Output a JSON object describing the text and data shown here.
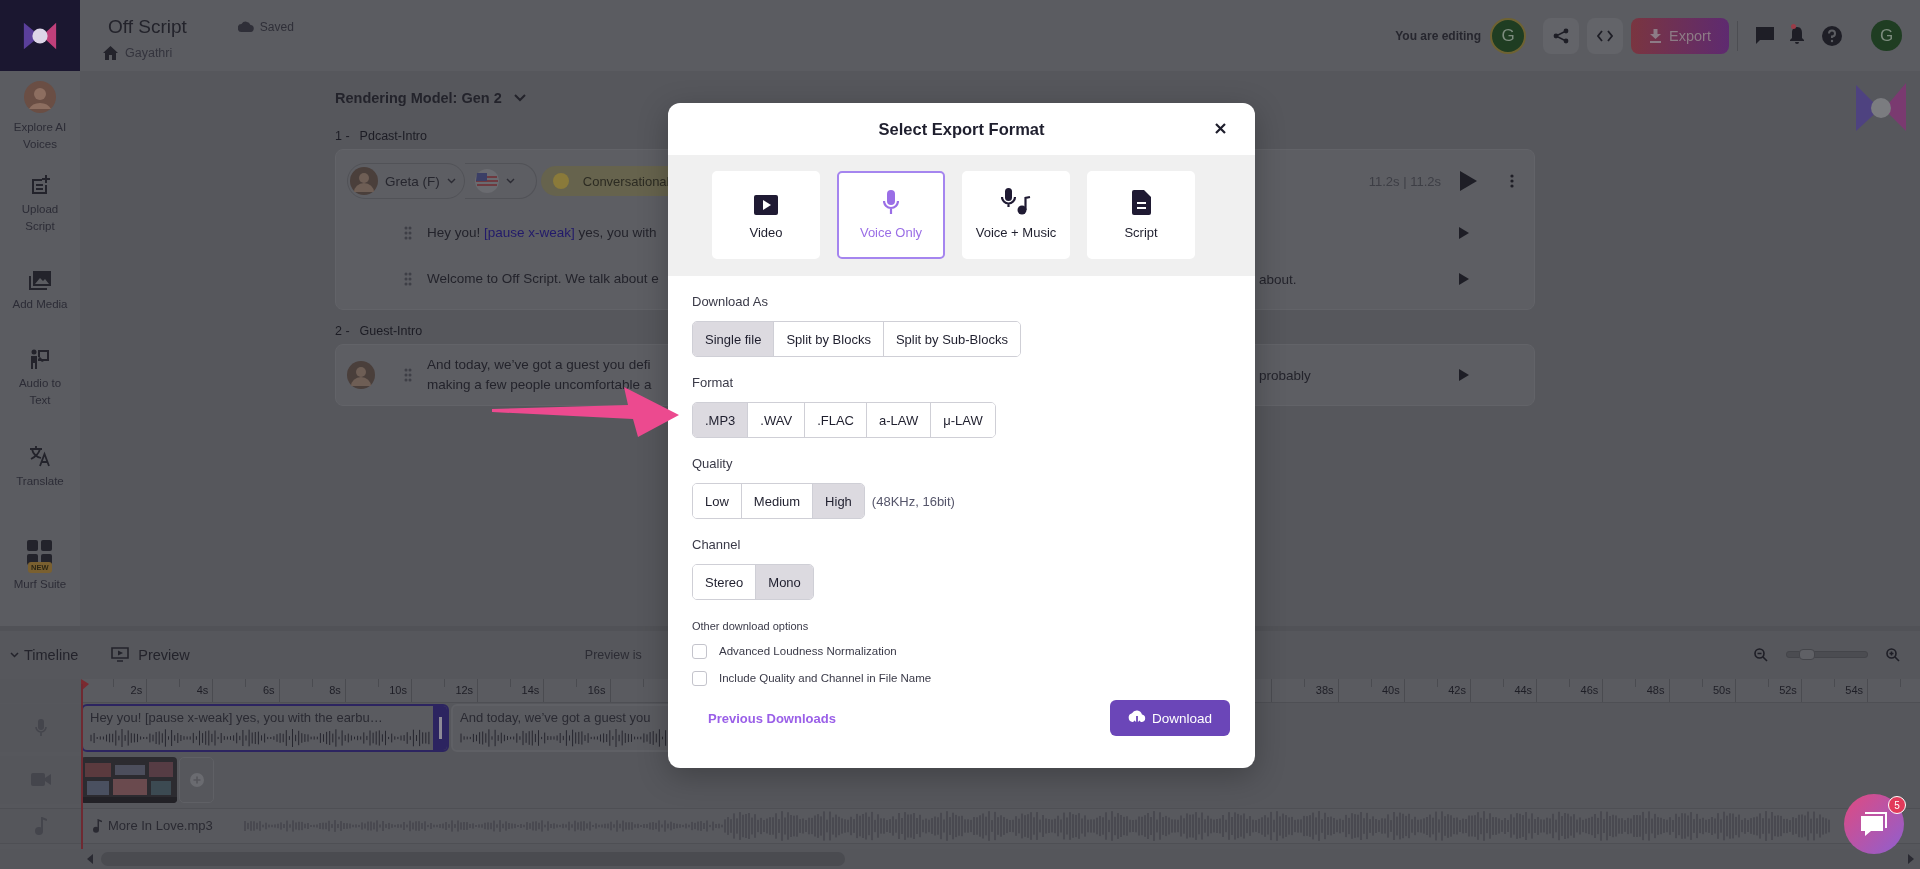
{
  "app": {
    "title": "Off Script",
    "save_status": "Saved",
    "breadcrumb": "Gayathri",
    "editing_label": "You are editing",
    "editing_avatar": "G",
    "export_button": "Export",
    "user_avatar": "G",
    "notifications": {
      "unread": true
    }
  },
  "sidebar": [
    {
      "kind": "avatar",
      "label": "Explore AI Voices"
    },
    {
      "kind": "upload",
      "label": "Upload Script"
    },
    {
      "kind": "media",
      "label": "Add Media"
    },
    {
      "kind": "audio-text",
      "label": "Audio to Text"
    },
    {
      "kind": "translate",
      "label": "Translate"
    },
    {
      "kind": "suite",
      "label": "Murf Suite",
      "badge": "NEW"
    }
  ],
  "editor": {
    "model_label": "Rendering Model: Gen 2",
    "blocks": [
      {
        "kind": "header",
        "number": "1 -",
        "name": "Pdcast-Intro",
        "voice": "Greta (F)",
        "style": "Conversational",
        "duration": "11.2s | 11.2s",
        "lines": [
          {
            "segments": [
              {
                "kind": "text",
                "text": "Hey you! "
              },
              {
                "kind": "pause",
                "text": "[pause x-weak]"
              },
              {
                "kind": "text",
                "text": " yes, you with"
              }
            ]
          },
          {
            "segments": [
              {
                "kind": "text",
                "text": "Welcome to Off Script. We talk about e"
              }
            ],
            "right_text": "about."
          }
        ]
      },
      {
        "kind": "compact",
        "number": "2 -",
        "name": "Guest-Intro",
        "lines": [
          {
            "segments": [
              {
                "kind": "text",
                "text": "And today, we’ve got a guest you defi"
              },
              {
                "kind": "break"
              },
              {
                "kind": "text",
                "text": "making a few people uncomfortable a"
              }
            ],
            "right_text": "probably"
          }
        ]
      }
    ]
  },
  "timeline": {
    "toggle": "Timeline",
    "preview": "Preview",
    "preview_note": "Preview is",
    "zoom": {
      "level": 0.25
    },
    "ruler_left": [
      "2s",
      "4s",
      "6s",
      "8s",
      "10s",
      "12s",
      "14s",
      "16s"
    ],
    "ruler_right": [
      "38s",
      "40s",
      "42s",
      "44s",
      "46s",
      "48s",
      "50s",
      "52s",
      "54s"
    ],
    "clips": [
      {
        "text": "Hey you! [pause x-weak] yes, you with the earbu…",
        "selected": true
      },
      {
        "text": "And today, we’ve got a guest you",
        "selected": false
      }
    ],
    "music": "More In Love.mp3"
  },
  "modal": {
    "title": "Select Export Format",
    "formats": [
      {
        "kind": "video",
        "label": "Video",
        "selected": false
      },
      {
        "kind": "voice",
        "label": "Voice Only",
        "selected": true
      },
      {
        "kind": "voice-music",
        "label": "Voice + Music",
        "selected": false
      },
      {
        "kind": "script",
        "label": "Script",
        "selected": false
      }
    ],
    "sections": [
      {
        "label": "Download As",
        "options": [
          {
            "label": "Single file",
            "selected": true
          },
          {
            "label": "Split by Blocks",
            "selected": false
          },
          {
            "label": "Split by Sub-Blocks",
            "selected": false
          }
        ]
      },
      {
        "label": "Format",
        "options": [
          {
            "label": ".MP3",
            "selected": true
          },
          {
            "label": ".WAV",
            "selected": false
          },
          {
            "label": ".FLAC",
            "selected": false
          },
          {
            "label": "a-LAW",
            "selected": false
          },
          {
            "label": "μ-LAW",
            "selected": false
          }
        ]
      },
      {
        "label": "Quality",
        "options": [
          {
            "label": "Low",
            "selected": false
          },
          {
            "label": "Medium",
            "selected": false
          },
          {
            "label": "High",
            "selected": true
          }
        ],
        "note": "(48KHz, 16bit)"
      },
      {
        "label": "Channel",
        "options": [
          {
            "label": "Stereo",
            "selected": false
          },
          {
            "label": "Mono",
            "selected": true
          }
        ]
      }
    ],
    "other_label": "Other download options",
    "checkboxes": [
      {
        "label": "Advanced Loudness Normalization",
        "checked": false
      },
      {
        "label": "Include Quality and Channel in File Name",
        "checked": false
      }
    ],
    "link": "Previous Downloads",
    "download_button": "Download"
  },
  "chat": {
    "badge": "5"
  }
}
